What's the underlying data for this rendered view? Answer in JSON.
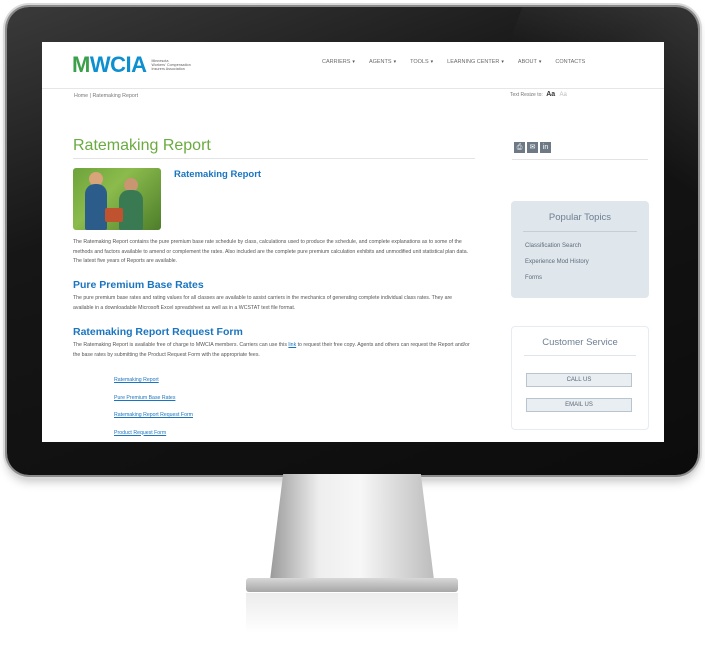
{
  "logo": {
    "mark": "WCIA",
    "mark_letter": "M",
    "tagline": [
      "Minnesota",
      "Workers' Compensation",
      "Insurers Association"
    ]
  },
  "nav": [
    {
      "label": "CARRIERS",
      "caret": "▾"
    },
    {
      "label": "AGENTS",
      "caret": "▾"
    },
    {
      "label": "TOOLS",
      "caret": "▾"
    },
    {
      "label": "LEARNING CENTER",
      "caret": "▾"
    },
    {
      "label": "ABOUT",
      "caret": "▾"
    },
    {
      "label": "CONTACTS",
      "caret": ""
    }
  ],
  "breadcrumb": "Home | Ratemaking Report",
  "text_resize": {
    "label": "Text Resize to:",
    "large": "Aa",
    "small": "Aa"
  },
  "page_title": "Ratemaking Report",
  "section_link_title": "Ratemaking Report",
  "intro_paragraph": "The Ratemaking Report contains the pure premium base rate schedule by class, calculations used to produce the schedule, and complete explanations as to some of the methods and factors available to amend or complement the rates. Also included are the complete pure premium calculation exhibits and unmodified unit statistical plan data. The latest five years of Reports are available.",
  "pure_premium": {
    "heading": "Pure Premium Base Rates",
    "text": "The pure premium base rates and rating values for all classes are available to assist carriers in the mechanics of generating complete individual class rates. They are available in a downloadable Microsoft Excel spreadsheet as well as in a WCSTAT text file format."
  },
  "request_form": {
    "heading": "Ratemaking Report Request Form",
    "text_before": "The Ratemaking Report is available free of charge to MWCIA members. Carriers can use this ",
    "link": "link",
    "text_after": " to request their free copy. Agents and others can request the Report and/or the base rates by submitting the Product Request Form with the appropriate fees."
  },
  "links": [
    "Ratemaking Report",
    "Pure Premium Base Rates",
    "Ratemaking Report Request Form",
    "Product Request Form"
  ],
  "share_icons": [
    "print-icon",
    "email-icon",
    "linkedin-icon"
  ],
  "share_glyphs": [
    "⎙",
    "✉",
    "in"
  ],
  "popular_topics": {
    "title": "Popular Topics",
    "items": [
      "Classification Search",
      "Experience Mod History",
      "Forms"
    ]
  },
  "customer_service": {
    "title": "Customer Service",
    "call_label": "CALL US",
    "email_label": "EMAIL US"
  },
  "colors": {
    "accent_green": "#6aab3f",
    "link_blue": "#1a75c0",
    "panel_gray": "#dfe6ec"
  }
}
